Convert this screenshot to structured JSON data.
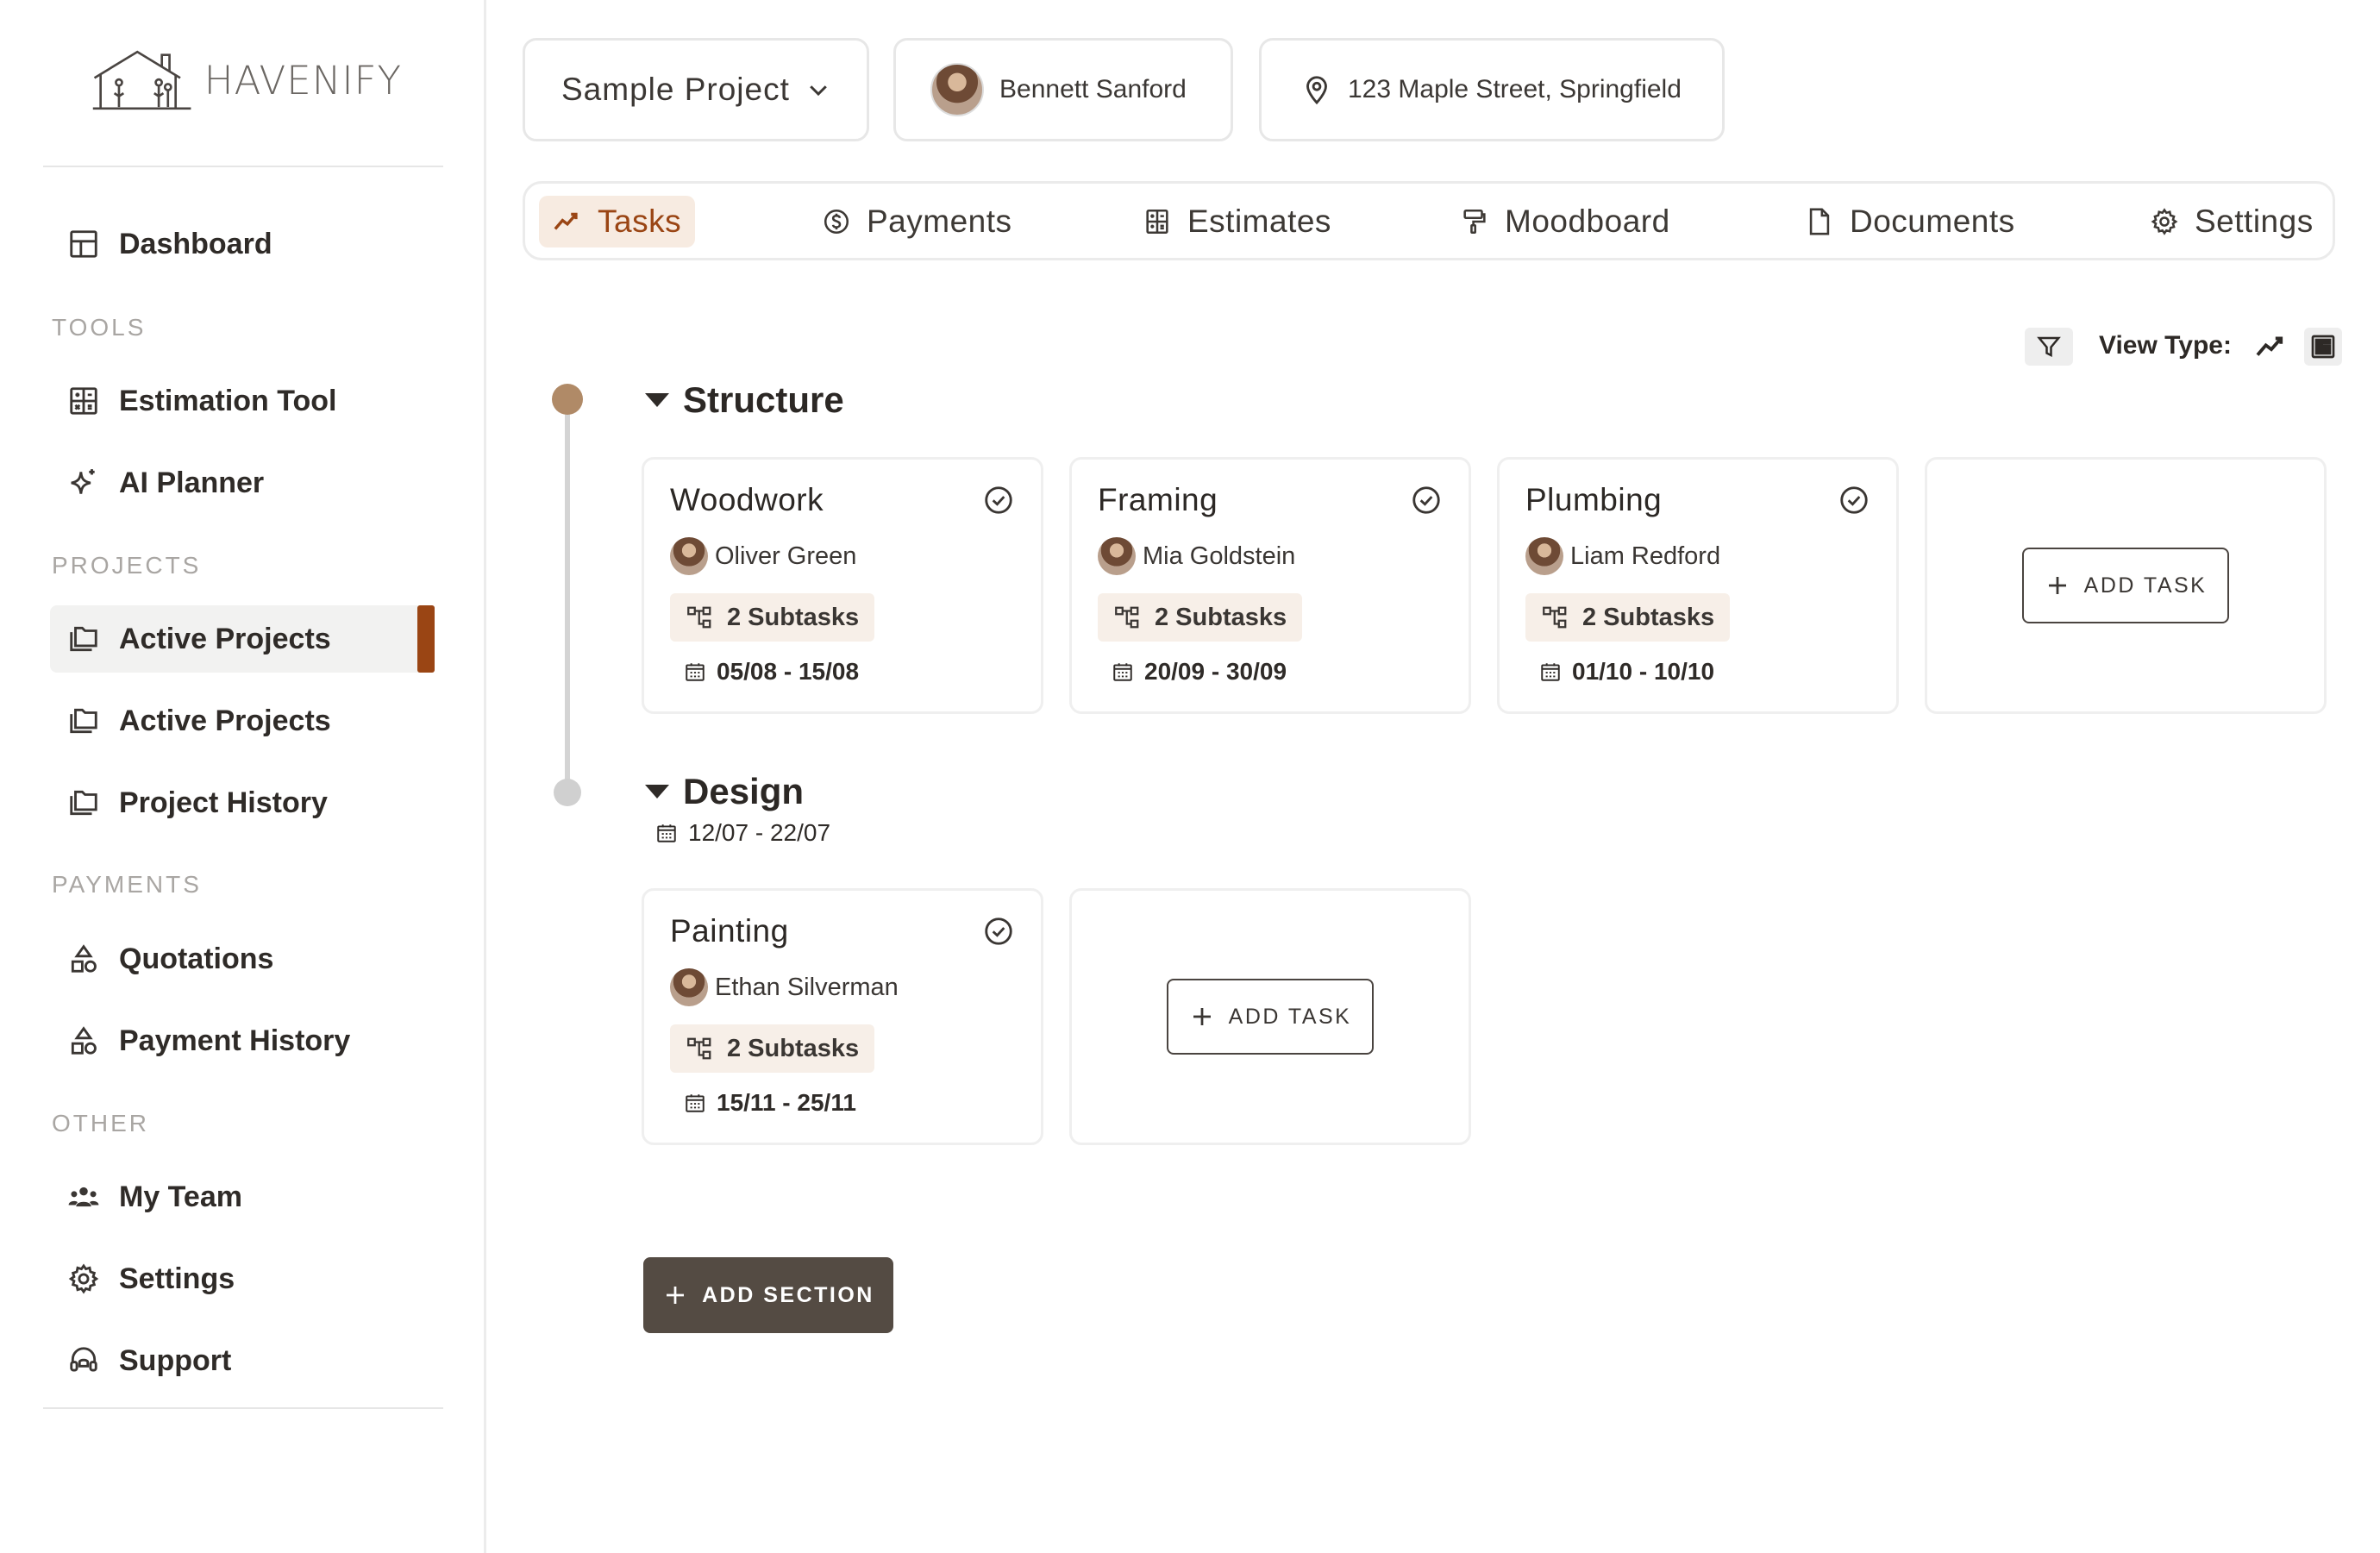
{
  "brand": {
    "name": "HAVENIFY"
  },
  "sidebar": {
    "dashboard": "Dashboard",
    "tools_heading": "TOOLS",
    "tools": [
      {
        "label": "Estimation Tool",
        "icon": "calculator-icon"
      },
      {
        "label": "AI Planner",
        "icon": "sparkle-icon"
      }
    ],
    "projects_heading": "PROJECTS",
    "projects": [
      {
        "label": "Active Projects",
        "icon": "folders-icon",
        "active": true
      },
      {
        "label": "Active Projects",
        "icon": "folders-icon"
      },
      {
        "label": "Project History",
        "icon": "folders-icon"
      }
    ],
    "payments_heading": "PAYMENTS",
    "payments": [
      {
        "label": "Quotations",
        "icon": "shapes-icon"
      },
      {
        "label": "Payment History",
        "icon": "shapes-icon"
      }
    ],
    "other_heading": "OTHER",
    "other": [
      {
        "label": "My Team",
        "icon": "team-icon"
      },
      {
        "label": "Settings",
        "icon": "gear-icon"
      },
      {
        "label": "Support",
        "icon": "headset-icon"
      }
    ]
  },
  "header": {
    "project": "Sample Project",
    "client": "Bennett Sanford",
    "address": "123 Maple Street, Springfield"
  },
  "tabs": [
    {
      "label": "Tasks",
      "icon": "trend-icon",
      "active": true
    },
    {
      "label": "Payments",
      "icon": "dollar-icon"
    },
    {
      "label": "Estimates",
      "icon": "calculator-icon"
    },
    {
      "label": "Moodboard",
      "icon": "paint-roller-icon"
    },
    {
      "label": "Documents",
      "icon": "document-icon"
    },
    {
      "label": "Settings",
      "icon": "gear-icon"
    }
  ],
  "view": {
    "label": "View Type:"
  },
  "sections": [
    {
      "title": "Structure",
      "tasks": [
        {
          "name": "Woodwork",
          "assignee": "Oliver Green",
          "subtasks": "2 Subtasks",
          "dates": "05/08 - 15/08"
        },
        {
          "name": "Framing",
          "assignee": "Mia Goldstein",
          "subtasks": "2 Subtasks",
          "dates": "20/09 - 30/09"
        },
        {
          "name": "Plumbing",
          "assignee": "Liam Redford",
          "subtasks": "2 Subtasks",
          "dates": "01/10 - 10/10"
        }
      ],
      "add_task": "ADD TASK"
    },
    {
      "title": "Design",
      "dates": "12/07 - 22/07",
      "tasks": [
        {
          "name": "Painting",
          "assignee": "Ethan Silverman",
          "subtasks": "2 Subtasks",
          "dates": "15/11 - 25/11"
        }
      ],
      "add_task": "ADD TASK"
    }
  ],
  "add_section": "ADD SECTION",
  "colors": {
    "accent": "#9a4514",
    "accent_bg": "#f7ebe1",
    "dark_button": "#544b43",
    "timeline_dot": "#b08a67"
  }
}
